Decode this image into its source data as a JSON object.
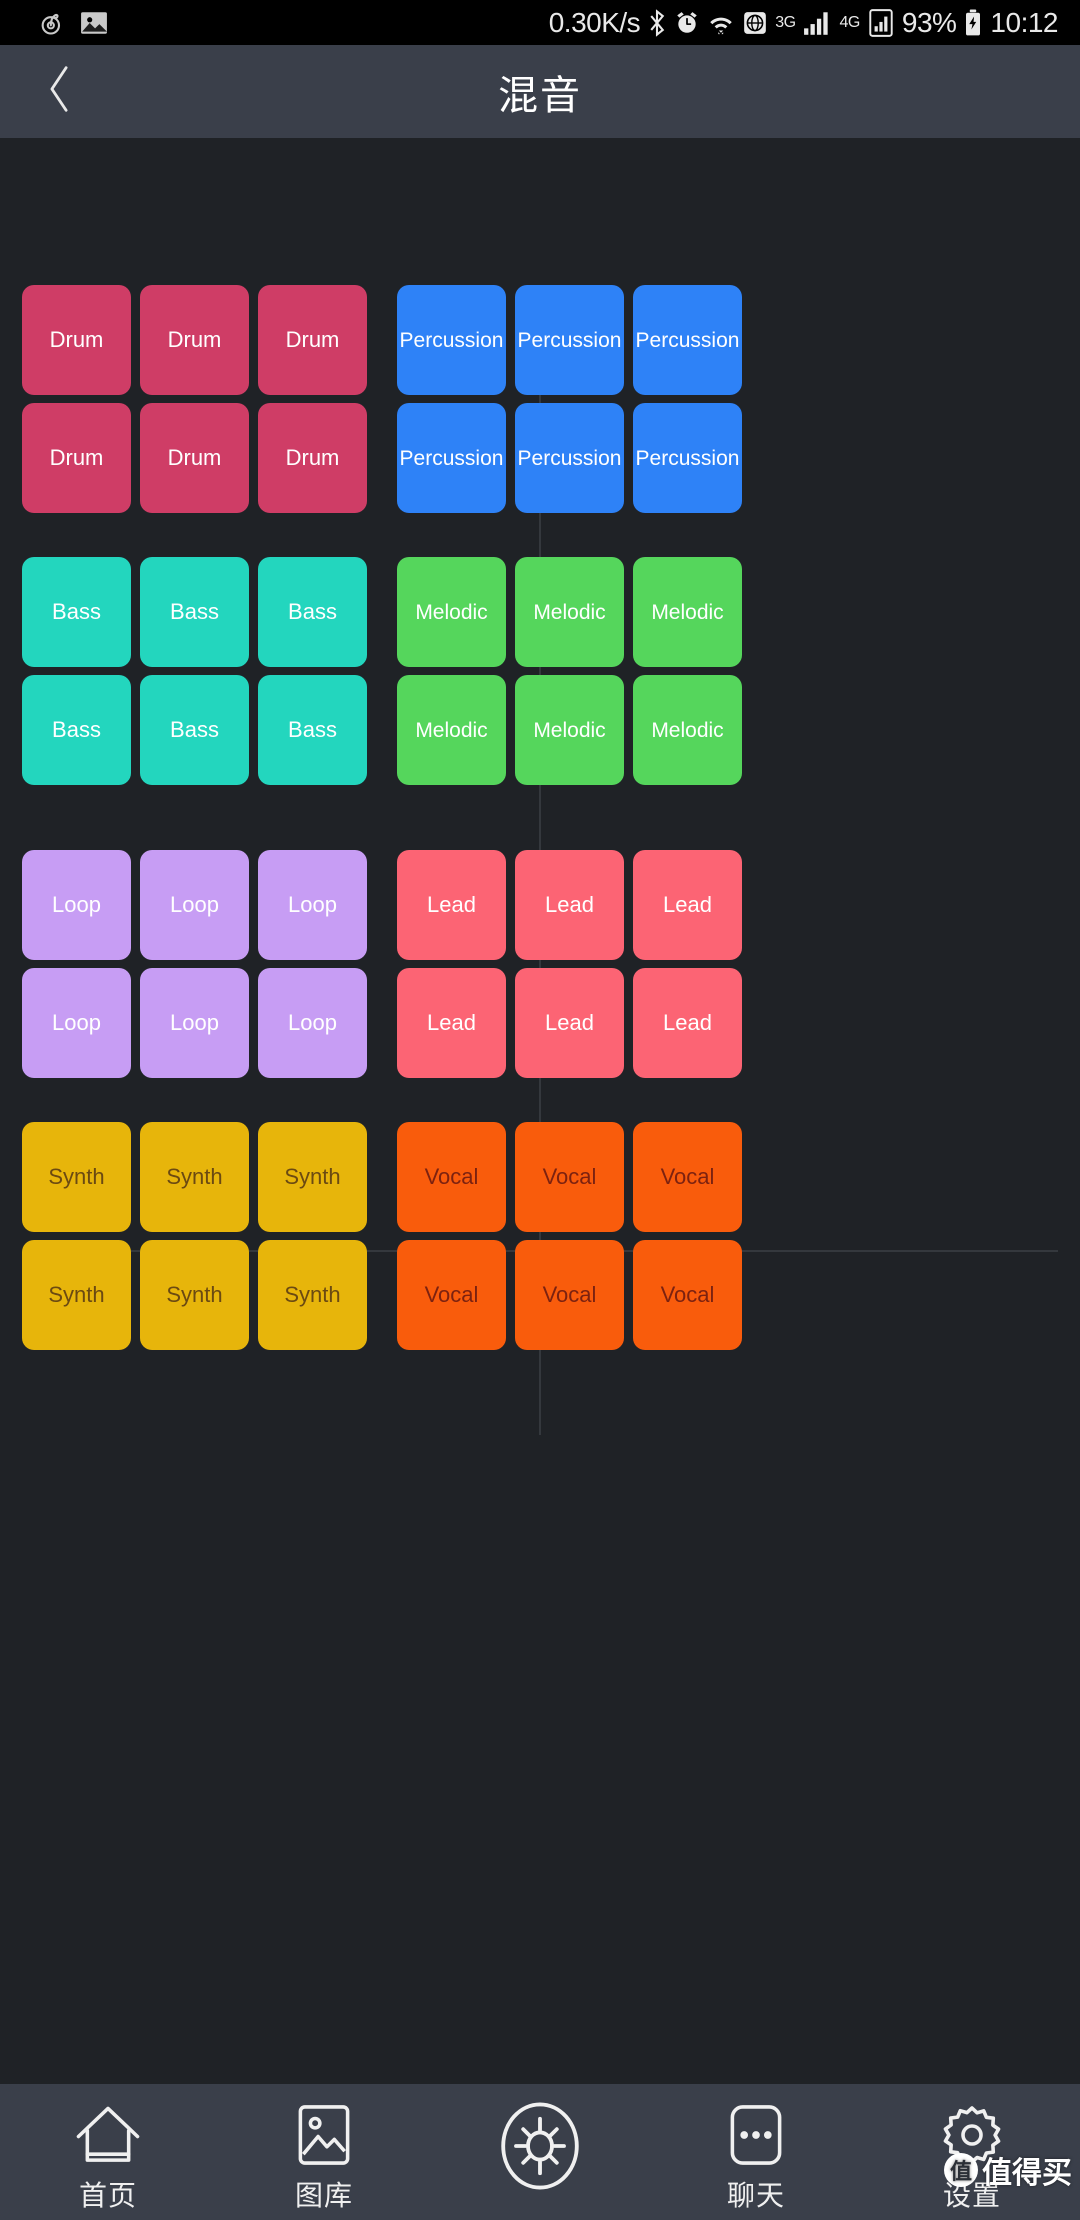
{
  "status_bar": {
    "left_icons": [
      "netease-music-icon",
      "gallery-icon"
    ],
    "network_speed": "0.30K/s",
    "icons": [
      "bluetooth-icon",
      "alarm-icon",
      "wifi-icon",
      "globe-icon"
    ],
    "network_3g": "3G",
    "network_4g": "4G",
    "battery_percent": "93%",
    "time": "10:12",
    "bg_color": "#000000"
  },
  "header": {
    "title": "混音",
    "back_icon": "chevron-left-icon",
    "bg_color": "#3a3f4a"
  },
  "board": {
    "bg_color": "#1f2226",
    "divider_color": "#34383d",
    "groups": [
      {
        "id": "drum",
        "label": "Drum",
        "color": "#cf3d66",
        "text_color": "#ffffff",
        "count": 6,
        "col": "left",
        "block": "top"
      },
      {
        "id": "percussion",
        "label": "Percussion",
        "color": "#2e82f7",
        "text_color": "#ffffff",
        "count": 6,
        "col": "right",
        "block": "top"
      },
      {
        "id": "bass",
        "label": "Bass",
        "color": "#23d6be",
        "text_color": "#ffffff",
        "count": 6,
        "col": "left",
        "block": "top"
      },
      {
        "id": "melodic",
        "label": "Melodic",
        "color": "#55d65c",
        "text_color": "#ffffff",
        "count": 6,
        "col": "right",
        "block": "top"
      },
      {
        "id": "loop",
        "label": "Loop",
        "color": "#c79df4",
        "text_color": "#ffffff",
        "count": 6,
        "col": "left",
        "block": "bottom"
      },
      {
        "id": "lead",
        "label": "Lead",
        "color": "#fc6474",
        "text_color": "#ffffff",
        "count": 6,
        "col": "right",
        "block": "bottom"
      },
      {
        "id": "synth",
        "label": "Synth",
        "color": "#e7b50b",
        "text_color": "#6b4a12",
        "count": 6,
        "col": "left",
        "block": "bottom"
      },
      {
        "id": "vocal",
        "label": "Vocal",
        "color": "#f95c0c",
        "text_color": "#7c2210",
        "count": 6,
        "col": "right",
        "block": "bottom"
      }
    ]
  },
  "bottom_nav": {
    "bg_color": "#3a3f4a",
    "items": [
      {
        "label": "首页",
        "icon": "home-icon"
      },
      {
        "label": "图库",
        "icon": "gallery-icon"
      },
      {
        "label": "",
        "icon": "brightness-sun-icon"
      },
      {
        "label": "聊天",
        "icon": "chat-dots-icon"
      },
      {
        "label": "设置",
        "icon": "gear-icon"
      }
    ]
  },
  "watermark": {
    "badge": "值",
    "text": "值得买"
  }
}
